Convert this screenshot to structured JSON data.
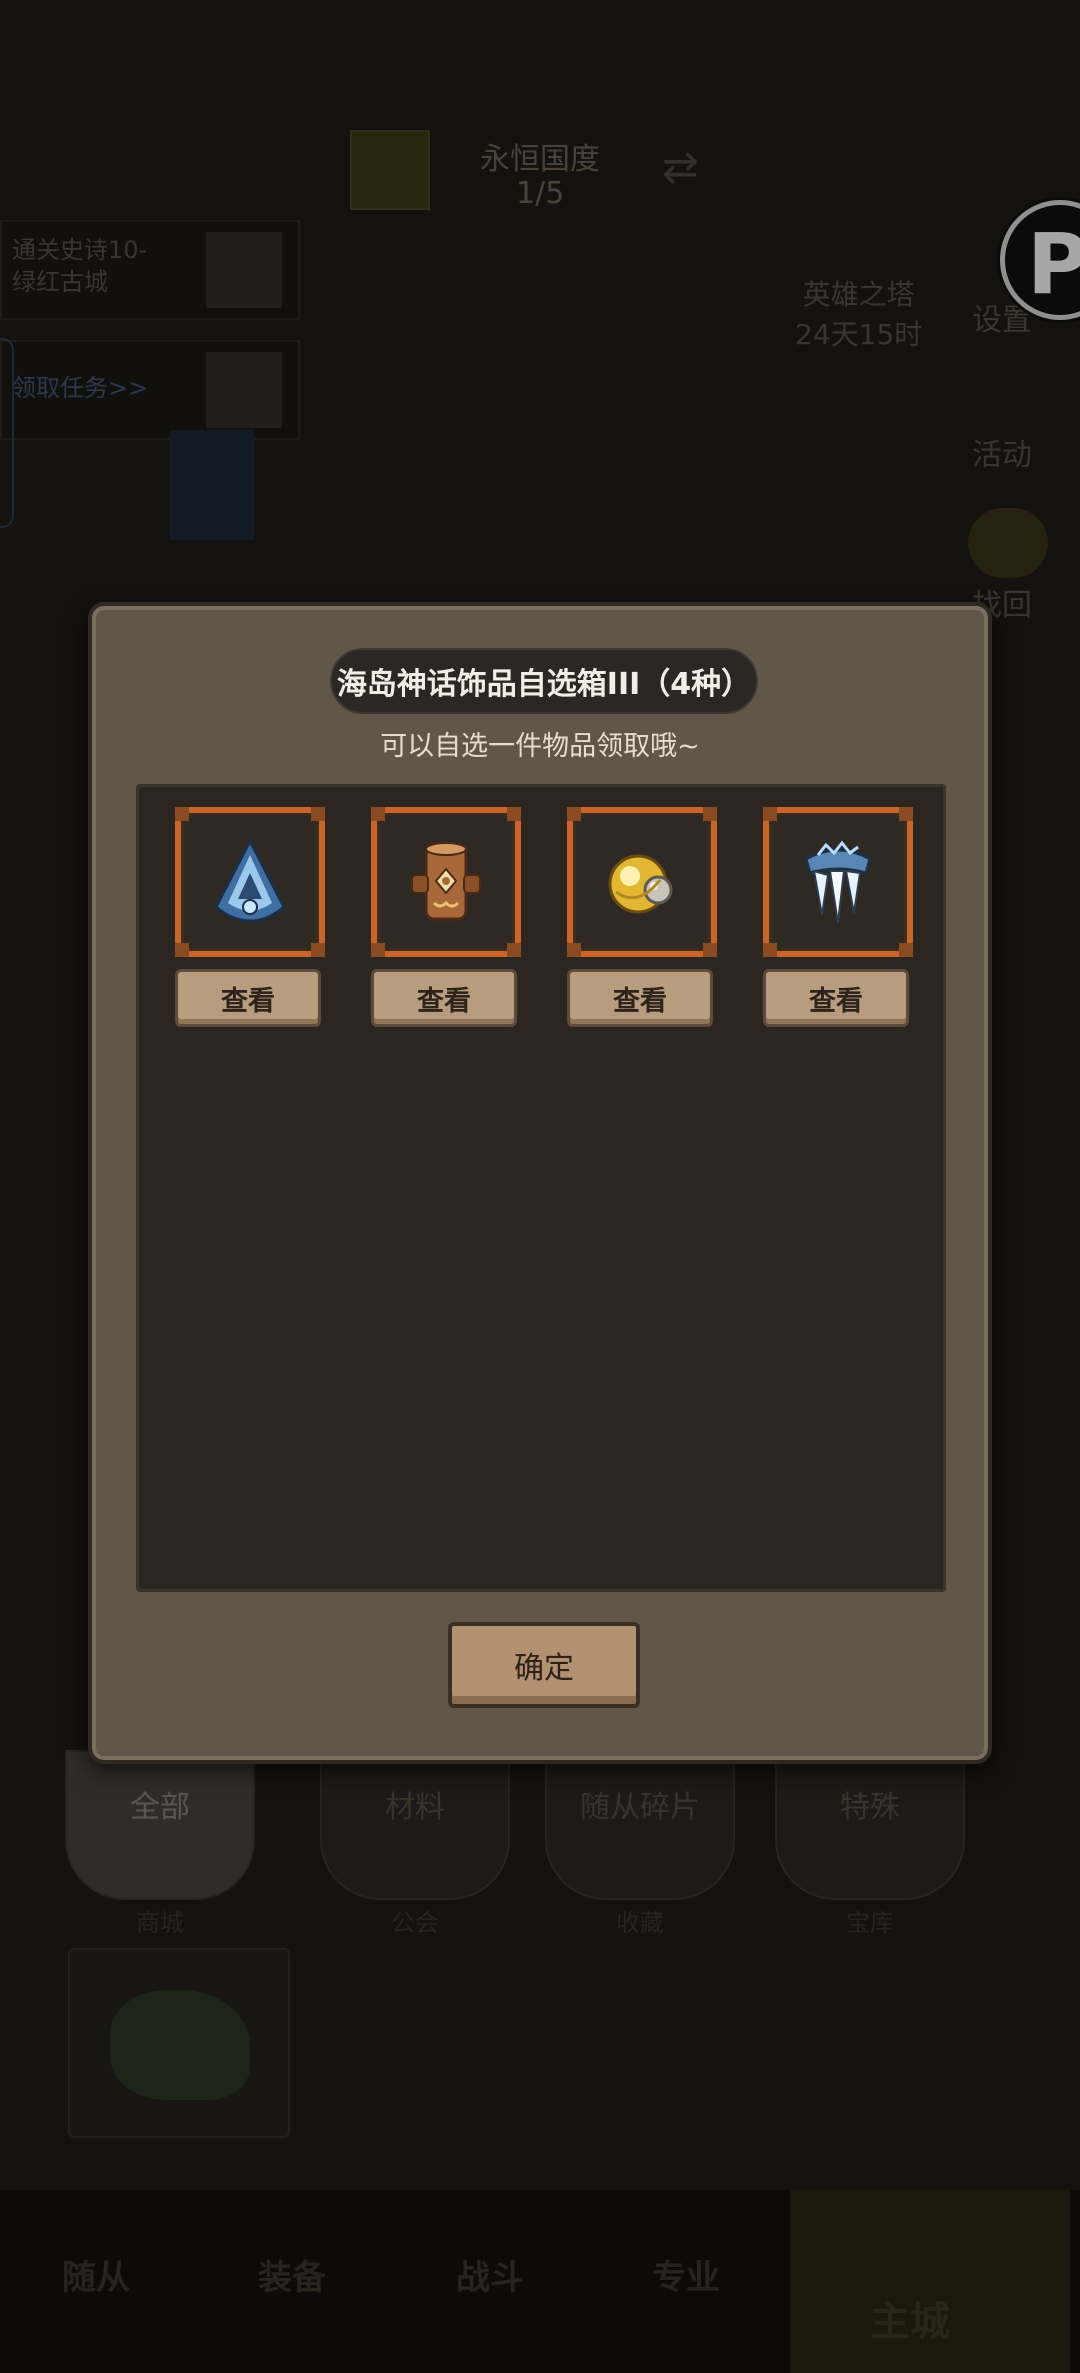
{
  "background": {
    "top_banner": {
      "title": "永恒国度",
      "progress": "1/5"
    },
    "quest_1": {
      "line1": "通关史诗10-",
      "line2": "绿红古城"
    },
    "quest_2": {
      "text": "领取任务>>"
    },
    "tower": {
      "name": "英雄之塔",
      "time": "24天15时"
    },
    "side_buttons": [
      "设置",
      "活动",
      "找回"
    ],
    "tabs": [
      "全部",
      "材料",
      "随从碎片",
      "特殊"
    ],
    "tab_bottoms": [
      "商城",
      "公会",
      "收藏",
      "宝库"
    ],
    "nav": [
      "随从",
      "装备",
      "战斗",
      "专业",
      "主城"
    ]
  },
  "dialog": {
    "title": "海岛神话饰品自选箱III（4种）",
    "subtitle": "可以自选一件物品领取哦~",
    "items": [
      {
        "icon": "blue-hood-amulet-icon",
        "view_label": "查看"
      },
      {
        "icon": "wooden-totem-icon",
        "view_label": "查看"
      },
      {
        "icon": "golden-orb-icon",
        "view_label": "查看"
      },
      {
        "icon": "ice-crystal-claw-icon",
        "view_label": "查看"
      }
    ],
    "confirm_label": "确定"
  },
  "colors": {
    "modal_bg": "#60574a",
    "slot_border": "#c9642a",
    "button_bg": "#b89c7e"
  }
}
